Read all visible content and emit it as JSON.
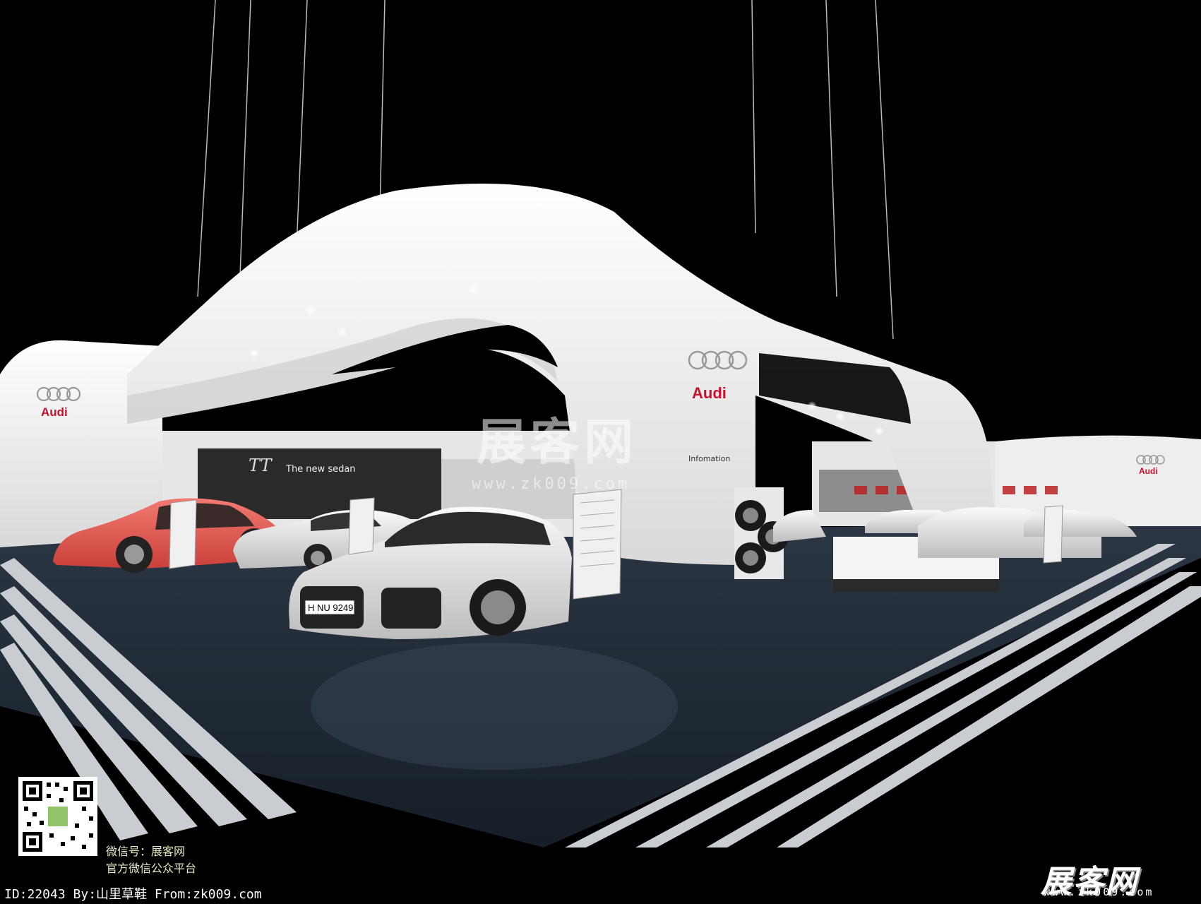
{
  "brand": {
    "logo_text": "Audi",
    "accent_color": "#c8102e"
  },
  "booth": {
    "tt_model": "TT",
    "tt_tagline": "The new sedan",
    "info_label": "Infomation",
    "license_plate": "H NU 9249"
  },
  "watermark": {
    "center_cn": "展客网",
    "center_url": "www.zk009.com",
    "bottom_cn": "展客网",
    "bottom_url": "www.zk009.com",
    "wechat_line1": "微信号：展客网",
    "wechat_line2": "官方微信公众平台",
    "credit": "ID:22043 By:山里草鞋 From:zk009.com"
  },
  "colors": {
    "background": "#000000",
    "structure": "#f2f2f2",
    "floor": "#1f2a36",
    "red_car": "#e8554d"
  }
}
